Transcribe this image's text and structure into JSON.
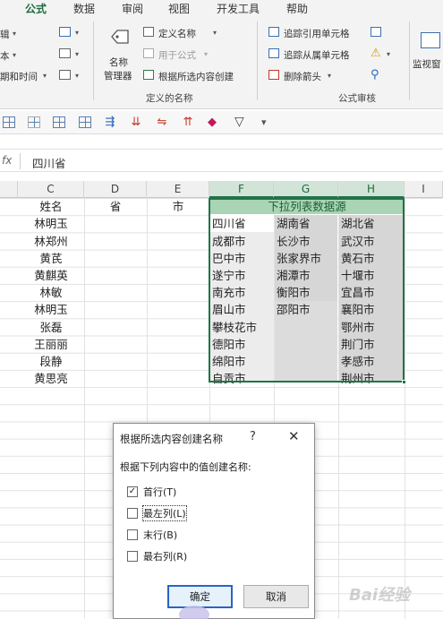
{
  "ribbon": {
    "tabs": [
      "公式",
      "数据",
      "审阅",
      "视图",
      "开发工具",
      "帮助"
    ],
    "active_tab": "公式",
    "left_items": [
      "辑",
      "本",
      "期和时间"
    ],
    "name_manager_label_1": "名称",
    "name_manager_label_2": "管理器",
    "define_name": "定义名称",
    "use_in_formula": "用于公式",
    "create_from_selection": "根据所选内容创建",
    "defined_names_group": "定义的名称",
    "trace_precedents": "追踪引用单元格",
    "trace_dependents": "追踪从属单元格",
    "remove_arrows": "删除箭头",
    "formula_auditing_group": "公式审核",
    "watch_window": "监视窗",
    "accent_color": "#217346"
  },
  "formula_bar": {
    "fx_label": "fx",
    "value": "四川省"
  },
  "sheet": {
    "columns": [
      "C",
      "D",
      "E",
      "F",
      "G",
      "H",
      "I"
    ],
    "row1": {
      "c": "姓名",
      "d": "省",
      "e": "市",
      "fgh": "下拉列表数据源"
    },
    "names": [
      "林明玉",
      "林郑州",
      "黄芪",
      "黄麒英",
      "林敏",
      "林明玉",
      "张磊",
      "王丽丽",
      "段静",
      "黄思亮"
    ],
    "col_f": [
      "四川省",
      "成都市",
      "巴中市",
      "遂宁市",
      "南充市",
      "眉山市",
      "攀枝花市",
      "德阳市",
      "绵阳市",
      "自贡市"
    ],
    "col_g": [
      "湖南省",
      "长沙市",
      "张家界市",
      "湘潭市",
      "衡阳市",
      "邵阳市",
      "",
      "",
      "",
      ""
    ],
    "col_h": [
      "湖北省",
      "武汉市",
      "黄石市",
      "十堰市",
      "宜昌市",
      "襄阳市",
      "鄂州市",
      "荆门市",
      "孝感市",
      "荆州市"
    ]
  },
  "dialog": {
    "title": "根据所选内容创建名称",
    "help": "?",
    "close": "✕",
    "prompt": "根据下列内容中的值创建名称:",
    "options": [
      {
        "label": "首行(T)",
        "checked": true
      },
      {
        "label": "最左列(L)",
        "checked": false
      },
      {
        "label": "末行(B)",
        "checked": false
      },
      {
        "label": "最右列(R)",
        "checked": false
      }
    ],
    "ok": "确定",
    "cancel": "取消"
  },
  "watermark": "Bai经验"
}
